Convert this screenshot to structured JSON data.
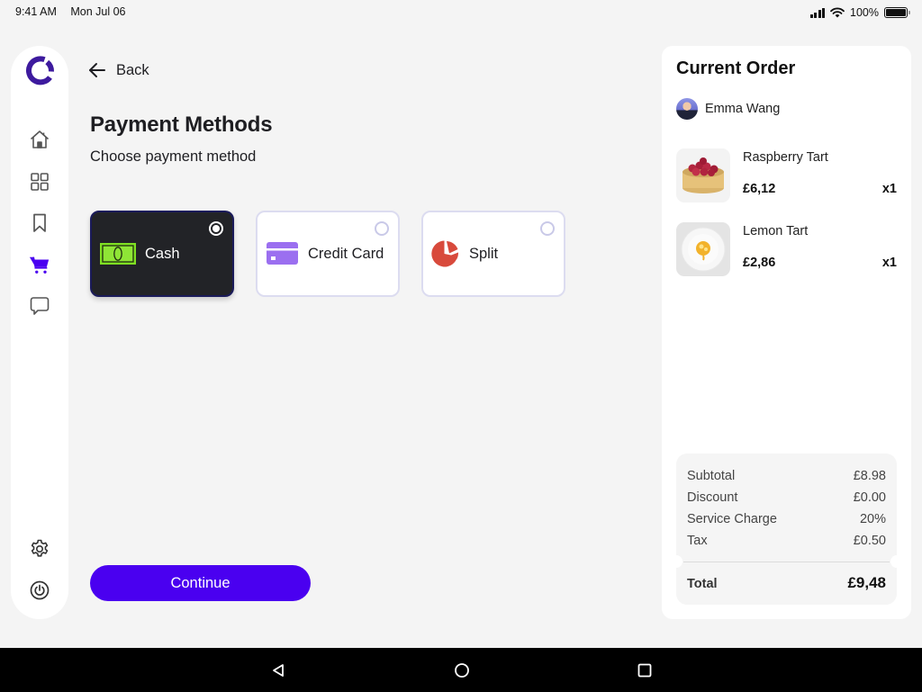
{
  "status_bar": {
    "time": "9:41 AM",
    "date": "Mon Jul 06",
    "battery": "100%"
  },
  "sidebar": {
    "logo": "brand-logo",
    "items": [
      {
        "name": "home",
        "icon": "home-icon",
        "active": false
      },
      {
        "name": "dashboard",
        "icon": "grid-icon",
        "active": false
      },
      {
        "name": "saved",
        "icon": "bookmark-icon",
        "active": false
      },
      {
        "name": "cart",
        "icon": "cart-icon",
        "active": true
      },
      {
        "name": "messages",
        "icon": "chat-icon",
        "active": false
      }
    ],
    "bottom_items": [
      {
        "name": "settings",
        "icon": "gear-icon"
      },
      {
        "name": "power",
        "icon": "power-icon"
      }
    ],
    "accent_color": "#4a00f0"
  },
  "main": {
    "back_label": "Back",
    "title": "Payment Methods",
    "subtitle": "Choose payment method",
    "payment_methods": [
      {
        "label": "Cash",
        "icon": "cash-icon",
        "selected": true
      },
      {
        "label": "Credit Card",
        "icon": "credit-card-icon",
        "selected": false
      },
      {
        "label": "Split",
        "icon": "pie-chart-icon",
        "selected": false
      }
    ],
    "continue_label": "Continue"
  },
  "order": {
    "title": "Current Order",
    "customer": "Emma Wang",
    "items": [
      {
        "name": "Raspberry Tart",
        "price": "£6,12",
        "qty": "x1"
      },
      {
        "name": "Lemon Tart",
        "price": "£2,86",
        "qty": "x1"
      }
    ],
    "summary": [
      {
        "label": "Subtotal",
        "value": "£8.98"
      },
      {
        "label": "Discount",
        "value": "£0.00"
      },
      {
        "label": "Service Charge",
        "value": "20%"
      },
      {
        "label": "Tax",
        "value": "£0.50"
      }
    ],
    "total_label": "Total",
    "total_value": "£9,48"
  },
  "navbar": {
    "buttons": [
      "back-triangle",
      "home-circle",
      "recents-square"
    ]
  }
}
